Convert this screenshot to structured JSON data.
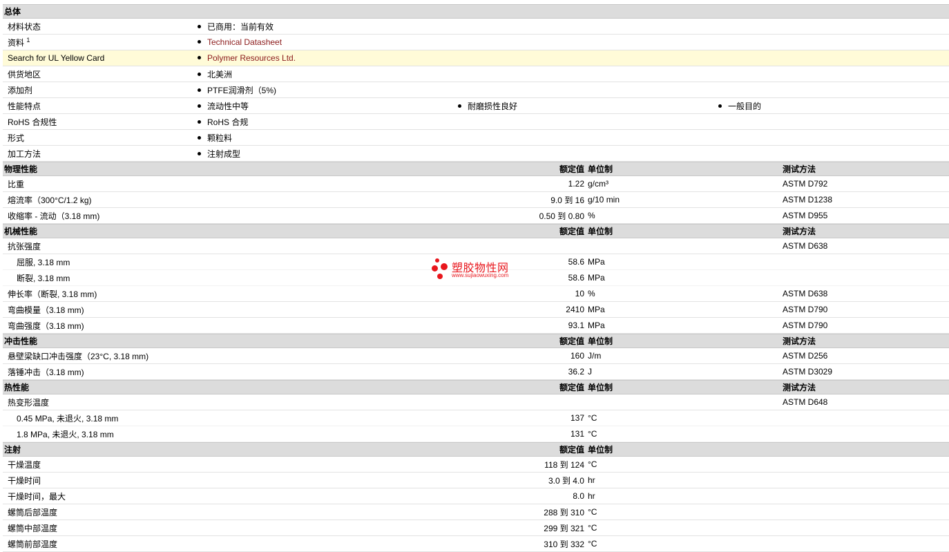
{
  "general": {
    "title": "总体",
    "material_status": {
      "label": "材料状态",
      "value": "已商用：当前有效"
    },
    "source": {
      "label": "资料",
      "footnote": "1",
      "value": "Technical Datasheet"
    },
    "ul": {
      "label": "Search for UL Yellow Card",
      "value": "Polymer Resources Ltd."
    },
    "region": {
      "label": "供货地区",
      "value": "北美洲"
    },
    "additive": {
      "label": "添加剂",
      "value": "PTFE润滑剂（5%)"
    },
    "features": {
      "label": "性能特点",
      "values": [
        "流动性中等",
        "耐磨损性良好",
        "一般目的"
      ]
    },
    "rohs": {
      "label": "RoHS 合规性",
      "value": "RoHS 合规"
    },
    "form": {
      "label": "形式",
      "value": "颗粒料"
    },
    "processing": {
      "label": "加工方法",
      "value": "注射成型"
    }
  },
  "headers": {
    "value": "额定值",
    "unit": "单位制",
    "method": "测试方法"
  },
  "physical": {
    "title": "物理性能",
    "rows": [
      {
        "label": "比重",
        "value": "1.22",
        "unit": "g/cm³",
        "method": "ASTM D792"
      },
      {
        "label": "熔流率（300°C/1.2 kg)",
        "value": "9.0 到  16",
        "unit": "g/10 min",
        "method": "ASTM D1238"
      },
      {
        "label": "收缩率 - 流动（3.18 mm)",
        "value": "0.50 到  0.80",
        "unit": "%",
        "method": "ASTM D955"
      }
    ]
  },
  "mechanical": {
    "title": "机械性能",
    "tensile": {
      "label": "抗张强度",
      "method": "ASTM D638"
    },
    "tensile_sub": [
      {
        "label": "屈服, 3.18 mm",
        "value": "58.6",
        "unit": "MPa"
      },
      {
        "label": "断裂, 3.18 mm",
        "value": "58.6",
        "unit": "MPa"
      }
    ],
    "rows": [
      {
        "label": "伸长率（断裂, 3.18 mm)",
        "value": "10",
        "unit": "%",
        "method": "ASTM D638"
      },
      {
        "label": "弯曲模量（3.18 mm)",
        "value": "2410",
        "unit": "MPa",
        "method": "ASTM D790"
      },
      {
        "label": "弯曲强度（3.18 mm)",
        "value": "93.1",
        "unit": "MPa",
        "method": "ASTM D790"
      }
    ]
  },
  "impact": {
    "title": "冲击性能",
    "rows": [
      {
        "label": "悬壁梁缺口冲击强度（23°C, 3.18 mm)",
        "value": "160",
        "unit": "J/m",
        "method": "ASTM D256"
      },
      {
        "label": "落锤冲击（3.18 mm)",
        "value": "36.2",
        "unit": "J",
        "method": "ASTM D3029"
      }
    ]
  },
  "thermal": {
    "title": "热性能",
    "hdt": {
      "label": "热变形温度",
      "method": "ASTM D648"
    },
    "hdt_sub": [
      {
        "label": "0.45 MPa, 未退火, 3.18 mm",
        "value": "137",
        "unit": "°C"
      },
      {
        "label": "1.8 MPa, 未退火, 3.18 mm",
        "value": "131",
        "unit": "°C"
      }
    ]
  },
  "injection": {
    "title": "注射",
    "rows": [
      {
        "label": "干燥温度",
        "value": "118 到  124",
        "unit": "°C"
      },
      {
        "label": "干燥时间",
        "value": "3.0 到  4.0",
        "unit": "hr"
      },
      {
        "label": "干燥时间，最大",
        "value": "8.0",
        "unit": "hr"
      },
      {
        "label": "螺筒后部温度",
        "value": "288 到  310",
        "unit": "°C"
      },
      {
        "label": "螺筒中部温度",
        "value": "299 到  321",
        "unit": "°C"
      },
      {
        "label": "螺筒前部温度",
        "value": "310 到  332",
        "unit": "°C"
      }
    ]
  },
  "watermark": {
    "name": "塑胶物性网",
    "url": "www.sujiaowuxing.com",
    "color": "#e8161c"
  }
}
